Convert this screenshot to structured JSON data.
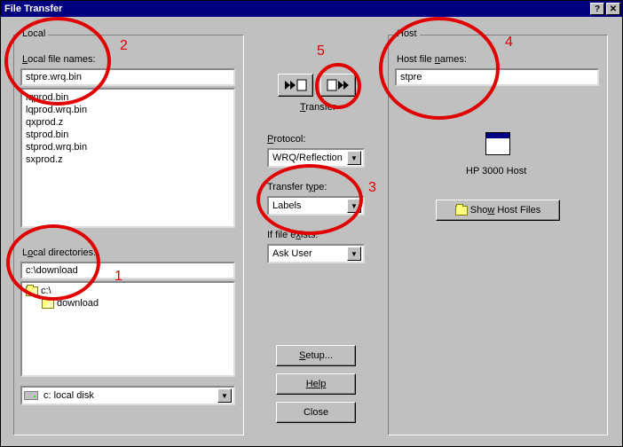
{
  "window": {
    "title": "File Transfer"
  },
  "local": {
    "legend": "Local",
    "filenames_label": "Local file names:",
    "filename_value": "stpre.wrq.bin",
    "files": [
      "lqprod.bin",
      "lqprod.wrq.bin",
      "qxprod.z",
      "stprod.bin",
      "stprod.wrq.bin",
      "sxprod.z"
    ],
    "dirs_label": "Local directories:",
    "dir_value": "c:\\download",
    "tree": {
      "root": "c:\\",
      "child": "download"
    },
    "drive": "c: local disk"
  },
  "center": {
    "transfer_label": "Transfer",
    "protocol_label": "Protocol:",
    "protocol_value": "WRQ/Reflection",
    "type_label": "Transfer type:",
    "type_value": "Labels",
    "exists_label": "If file exists:",
    "exists_value": "Ask User",
    "setup_label": "Setup...",
    "help_label": "Help",
    "close_label": "Close"
  },
  "host": {
    "legend": "Host",
    "filenames_label": "Host file names:",
    "filename_value": "stpre",
    "host_label": "HP 3000 Host",
    "show_label": "Show Host Files"
  },
  "annotations": {
    "n1": "1",
    "n2": "2",
    "n3": "3",
    "n4": "4",
    "n5": "5"
  }
}
